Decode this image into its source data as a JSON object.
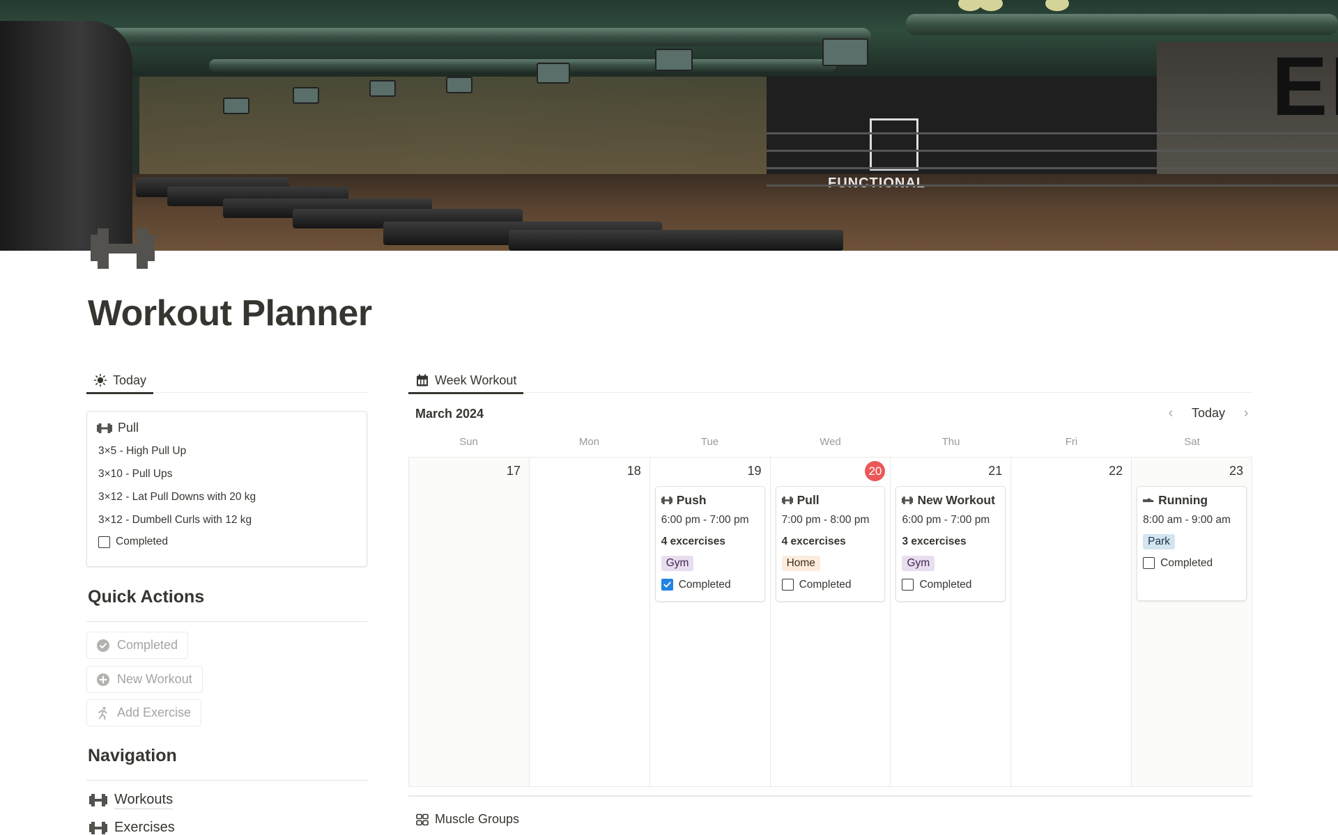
{
  "page": {
    "title": "Workout Planner",
    "icon": "dumbbell-icon"
  },
  "today": {
    "tab_label": "Today",
    "tab_icon": "sun-icon",
    "card": {
      "title": "Pull",
      "icon": "dumbbell-icon",
      "exercises": [
        "3×5 - High Pull Up",
        "3×10 - Pull Ups",
        "3×12 - Lat Pull Downs with 20 kg",
        "3×12 - Dumbell Curls with 12 kg"
      ],
      "completed_label": "Completed",
      "completed": false
    }
  },
  "quick_actions": {
    "heading": "Quick Actions",
    "buttons": [
      {
        "label": "Completed",
        "icon": "check-circle-icon"
      },
      {
        "label": "New Workout",
        "icon": "plus-circle-icon"
      },
      {
        "label": "Add Exercise",
        "icon": "running-person-icon"
      }
    ]
  },
  "navigation": {
    "heading": "Navigation",
    "items": [
      {
        "label": "Workouts",
        "icon": "dumbbell-icon"
      },
      {
        "label": "Exercises",
        "icon": "dumbbell-icon"
      }
    ]
  },
  "week": {
    "tab_label": "Week Workout",
    "tab_icon": "calendar-icon",
    "month_label": "March 2024",
    "today_button": "Today",
    "prev_icon": "chevron-left-icon",
    "next_icon": "chevron-right-icon",
    "days_of_week": [
      "Sun",
      "Mon",
      "Tue",
      "Wed",
      "Thu",
      "Fri",
      "Sat"
    ],
    "days": [
      {
        "date": "17",
        "weekend": true,
        "today": false,
        "events": []
      },
      {
        "date": "18",
        "weekend": false,
        "today": false,
        "events": []
      },
      {
        "date": "19",
        "weekend": false,
        "today": false,
        "events": [
          {
            "title": "Push",
            "icon": "dumbbell-icon",
            "time": "6:00 pm - 7:00 pm",
            "count": "4 excercises",
            "tag": "Gym",
            "tag_color": "purple",
            "completed_label": "Completed",
            "completed": true
          }
        ]
      },
      {
        "date": "20",
        "weekend": false,
        "today": true,
        "events": [
          {
            "title": "Pull",
            "icon": "dumbbell-icon",
            "time": "7:00 pm - 8:00 pm",
            "count": "4 excercises",
            "tag": "Home",
            "tag_color": "yellow",
            "completed_label": "Completed",
            "completed": false
          }
        ]
      },
      {
        "date": "21",
        "weekend": false,
        "today": false,
        "events": [
          {
            "title": "New Workout",
            "icon": "dumbbell-icon",
            "time": "6:00 pm - 7:00 pm",
            "count": "3 excercises",
            "tag": "Gym",
            "tag_color": "purple",
            "completed_label": "Completed",
            "completed": false
          }
        ]
      },
      {
        "date": "22",
        "weekend": false,
        "today": false,
        "events": []
      },
      {
        "date": "23",
        "weekend": true,
        "today": false,
        "events": [
          {
            "title": "Running",
            "icon": "running-shoe-icon",
            "time": "8:00 am - 9:00 am",
            "count": "",
            "tag": "Park",
            "tag_color": "blue",
            "completed_label": "Completed",
            "completed": false
          }
        ]
      }
    ]
  },
  "muscle_groups": {
    "label": "Muscle Groups",
    "icon": "gallery-grid-icon"
  },
  "colors": {
    "text": "#37352f",
    "muted": "#9b9a97",
    "today_badge": "#eb5757",
    "checkbox_checked": "#2383e2",
    "tags": {
      "purple": {
        "bg": "#e8deee",
        "fg": "#412454"
      },
      "yellow": {
        "bg": "#fbecdd",
        "fg": "#402c1b"
      },
      "blue": {
        "bg": "#d3e5ef",
        "fg": "#183347"
      }
    }
  }
}
